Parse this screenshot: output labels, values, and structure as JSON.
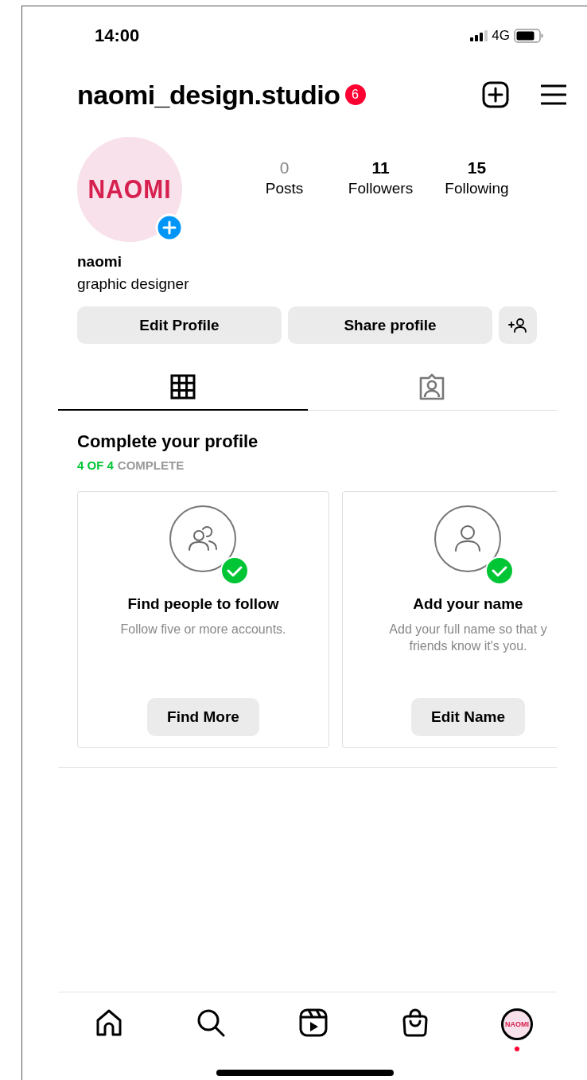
{
  "status_bar": {
    "time": "14:00",
    "network": "4G"
  },
  "header": {
    "username": "naomi_design.studio",
    "badge": "6"
  },
  "profile": {
    "avatar_text": "NAOMI",
    "name": "naomi",
    "bio": "graphic designer",
    "stats": [
      {
        "value": "0",
        "label": "Posts",
        "muted": true
      },
      {
        "value": "11",
        "label": "Followers",
        "muted": false
      },
      {
        "value": "15",
        "label": "Following",
        "muted": false
      }
    ]
  },
  "actions": [
    "Edit Profile",
    "Share profile"
  ],
  "tabs": [
    {
      "kind": "grid",
      "selected": true
    },
    {
      "kind": "tagged",
      "selected": false
    }
  ],
  "completion": {
    "title": "Complete your profile",
    "progress": "4 OF 4",
    "status": "COMPLETE",
    "cards": [
      {
        "kind": "people",
        "completed": true,
        "title": "Find people to follow",
        "description": [
          "Follow five or more accounts."
        ],
        "button": "Find More"
      },
      {
        "kind": "person",
        "completed": true,
        "title": "Add your name",
        "description": [
          "Add your full name so that y",
          "friends know it's you."
        ],
        "button": "Edit Name"
      }
    ]
  },
  "nav": [
    {
      "kind": "home",
      "selected": false,
      "dot": false
    },
    {
      "kind": "search",
      "selected": false,
      "dot": false
    },
    {
      "kind": "reels",
      "selected": false,
      "dot": false
    },
    {
      "kind": "shop",
      "selected": false,
      "dot": false
    },
    {
      "kind": "profile",
      "selected": true,
      "dot": true,
      "avatar_text": "NAOMI"
    }
  ]
}
